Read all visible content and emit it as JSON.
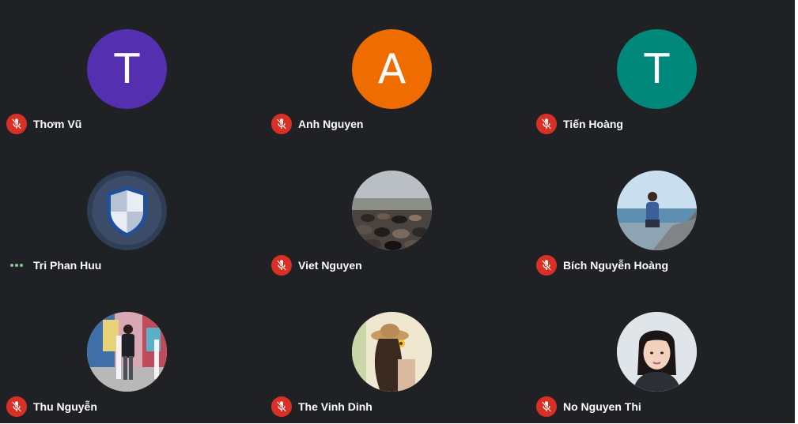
{
  "colors": {
    "background": "#202124",
    "mute_badge": "#d93025",
    "dots": "#81c995"
  },
  "participants": [
    {
      "name": "Thơm Vũ",
      "avatar": {
        "type": "letter",
        "letter": "T",
        "color": "#5430b0"
      },
      "status": "muted"
    },
    {
      "name": "Anh Nguyen",
      "avatar": {
        "type": "letter",
        "letter": "A",
        "color": "#ef6c00"
      },
      "status": "muted"
    },
    {
      "name": "Tiến Hoàng",
      "avatar": {
        "type": "letter",
        "letter": "T",
        "color": "#00897b"
      },
      "status": "muted"
    },
    {
      "name": "Tri Phan Huu",
      "avatar": {
        "type": "image",
        "icon": "shield-icon"
      },
      "status": "speaking"
    },
    {
      "name": "Viet Nguyen",
      "avatar": {
        "type": "image",
        "icon": "pebbles-photo"
      },
      "status": "muted"
    },
    {
      "name": "Bích Nguyễn Hoàng",
      "avatar": {
        "type": "image",
        "icon": "beach-person-photo"
      },
      "status": "muted"
    },
    {
      "name": "Thu Nguyễn",
      "avatar": {
        "type": "image",
        "icon": "man-mural-photo"
      },
      "status": "muted"
    },
    {
      "name": "The Vinh Dinh",
      "avatar": {
        "type": "image",
        "icon": "woman-hat-photo"
      },
      "status": "muted"
    },
    {
      "name": "No Nguyen Thi",
      "avatar": {
        "type": "image",
        "icon": "woman-portrait-photo"
      },
      "status": "muted"
    }
  ]
}
